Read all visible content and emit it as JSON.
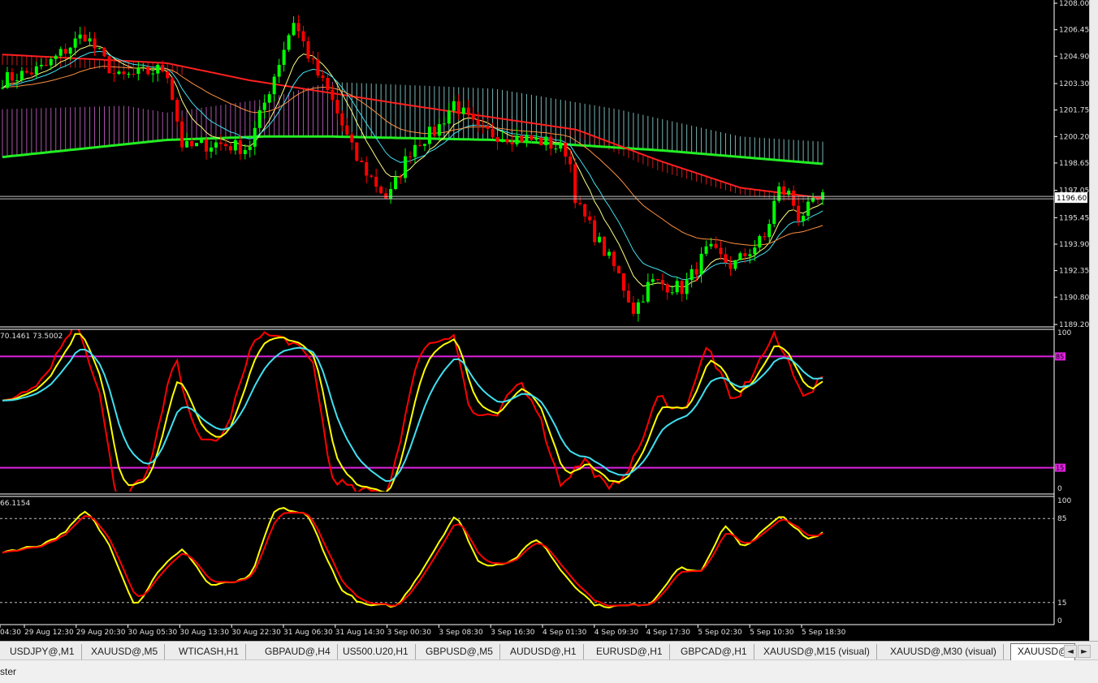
{
  "main_chart": {
    "price_axis_labels": [
      "1208.00",
      "1206.45",
      "1204.90",
      "1203.30",
      "1201.75",
      "1200.20",
      "1198.65",
      "1197.05",
      "1195.45",
      "1193.90",
      "1192.35",
      "1190.80",
      "1189.20"
    ],
    "current_price": "1196.60",
    "colors": {
      "bull": "#00ff00",
      "bear": "#ff0000",
      "ma_green": "#22ee22",
      "ma_red": "#ff2020",
      "ma_cyan": "#40e0f0",
      "ma_yellow": "#ffff80",
      "ma_blue": "#2030ff",
      "ribbon_cyan": "#a0f0f0",
      "ribbon_magenta": "#e070e0"
    }
  },
  "indicator1": {
    "label": "70.1461 73.5002",
    "scale": [
      "100",
      "0"
    ],
    "levels": [
      "85",
      "15"
    ],
    "colors": {
      "fast": "#ff0000",
      "mid": "#ffff00",
      "slow": "#40e0f0",
      "level": "#e020e0"
    }
  },
  "indicator2": {
    "label": "66.1154",
    "scale": [
      "100",
      "85",
      "15",
      "0"
    ],
    "colors": {
      "main": "#ff0000",
      "signal": "#ffff00"
    }
  },
  "time_axis": [
    "04:30",
    "29 Aug 12:30",
    "29 Aug 20:30",
    "30 Aug 05:30",
    "30 Aug 13:30",
    "30 Aug 22:30",
    "31 Aug 06:30",
    "31 Aug 14:30",
    "3 Sep 00:30",
    "3 Sep 08:30",
    "3 Sep 16:30",
    "4 Sep 01:30",
    "4 Sep 09:30",
    "4 Sep 17:30",
    "5 Sep 02:30",
    "5 Sep 10:30",
    "5 Sep 18:30"
  ],
  "tabs": [
    "USDJPY@,M1",
    "XAUUSD@,M5",
    "WTICASH,H1",
    "GBPAUD@,H4",
    "US500.U20,H1",
    "GBPUSD@,M5",
    "AUDUSD@,H1",
    "EURUSD@,H1",
    "GBPCAD@,H1",
    "XAUUSD@,M15 (visual)",
    "XAUUSD@,M30 (visual)",
    "XAUUSD@"
  ],
  "active_tab": "XAUUSD@",
  "tab_arrows": [
    "◄",
    "►"
  ],
  "status_text": "ster"
}
